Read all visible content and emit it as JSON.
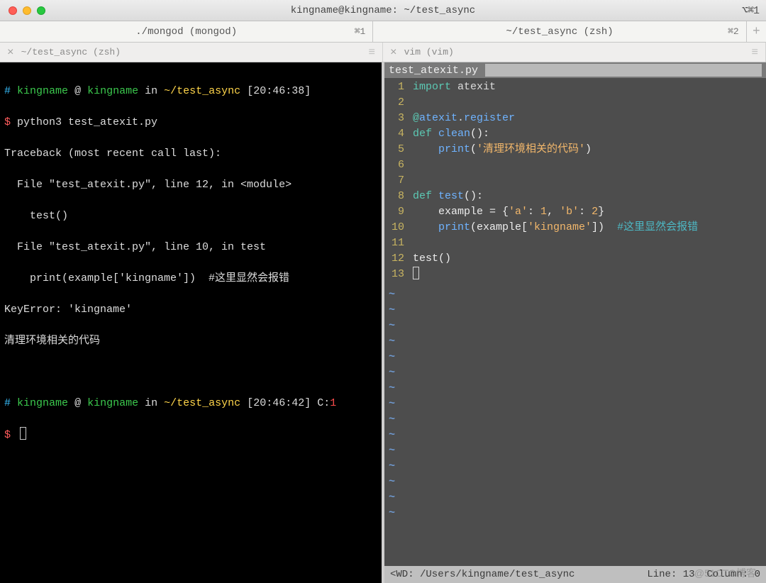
{
  "window": {
    "title": "kingname@kingname: ~/test_async",
    "right_hint": "⌥⌘1"
  },
  "tabs": [
    {
      "label": "./mongod (mongod)",
      "hotkey": "⌘1"
    },
    {
      "label": "~/test_async (zsh)",
      "hotkey": "⌘2"
    }
  ],
  "subtabs": [
    {
      "label": "~/test_async (zsh)"
    },
    {
      "label": "vim (vim)"
    }
  ],
  "terminal": {
    "prompts": [
      {
        "hash": "#",
        "user": "kingname",
        "at": "@",
        "host": "kingname",
        "in": "in",
        "path": "~/test_async",
        "time": "[20:46:38]",
        "c_label": "",
        "c_val": "",
        "cmd_prefix": "$",
        "cmd": "python3 test_atexit.py"
      },
      {
        "hash": "#",
        "user": "kingname",
        "at": "@",
        "host": "kingname",
        "in": "in",
        "path": "~/test_async",
        "time": "[20:46:42]",
        "c_label": "C:",
        "c_val": "1",
        "cmd_prefix": "$",
        "cmd": ""
      }
    ],
    "output": [
      "Traceback (most recent call last):",
      "  File \"test_atexit.py\", line 12, in <module>",
      "    test()",
      "  File \"test_atexit.py\", line 10, in test",
      "    print(example['kingname'])  #这里显然会报错",
      "KeyError: 'kingname'",
      "清理环境相关的代码"
    ]
  },
  "vim": {
    "filename": "test_atexit.py",
    "lines": [
      {
        "n": "1",
        "kind": "import",
        "a": "import",
        "b": "atexit"
      },
      {
        "n": "2",
        "kind": "blank"
      },
      {
        "n": "3",
        "kind": "dec",
        "at": "@",
        "a": "atexit",
        "dot": ".",
        "b": "register"
      },
      {
        "n": "4",
        "kind": "def",
        "a": "def",
        "b": "clean",
        "c": "():"
      },
      {
        "n": "5",
        "kind": "print",
        "indent": "    ",
        "fn": "print",
        "paren_l": "(",
        "str": "'清理环境相关的代码'",
        "paren_r": ")"
      },
      {
        "n": "6",
        "kind": "blank"
      },
      {
        "n": "7",
        "kind": "blank"
      },
      {
        "n": "8",
        "kind": "def",
        "a": "def",
        "b": "test",
        "c": "():"
      },
      {
        "n": "9",
        "kind": "assign",
        "indent": "    ",
        "text_a": "example = {",
        "s1": "'a'",
        "c1": ": ",
        "n1": "1",
        "c2": ", ",
        "s2": "'b'",
        "c3": ": ",
        "n2": "2",
        "text_b": "}"
      },
      {
        "n": "10",
        "kind": "print2",
        "indent": "    ",
        "fn": "print",
        "paren_l": "(",
        "mid": "example[",
        "str": "'kingname'",
        "mid2": "])",
        "sp": "  ",
        "cmt": "#这里显然会报错"
      },
      {
        "n": "11",
        "kind": "blank"
      },
      {
        "n": "12",
        "kind": "call",
        "text": "test()"
      },
      {
        "n": "13",
        "kind": "cursor"
      }
    ],
    "tildes": 15,
    "status": {
      "left": "<WD: /Users/kingname/test_async",
      "right": "Line: 13  Column: 0"
    }
  },
  "watermark": "@51CTO博客"
}
